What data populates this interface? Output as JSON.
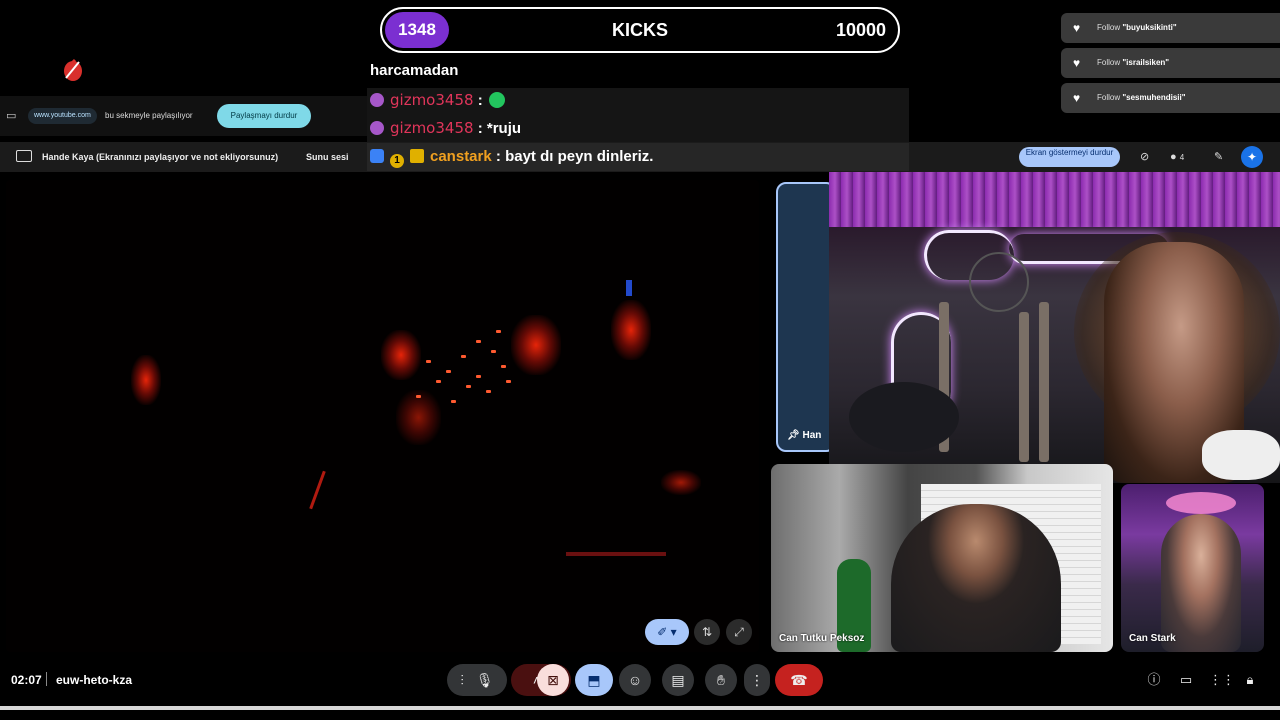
{
  "kicks": {
    "current": "1348",
    "label": "KICKS",
    "goal": "10000"
  },
  "chat": [
    {
      "user": "",
      "message": "harcamadan"
    },
    {
      "user": "gizmo3458",
      "sep": ":",
      "message": ""
    },
    {
      "user": "gizmo3458",
      "sep": ":",
      "message": "*ruju"
    },
    {
      "user": "canstark",
      "sep": ":",
      "message": "bayt dı peyn dinleriz.",
      "badge_num": "1"
    }
  ],
  "follows": [
    {
      "prefix": "Follow",
      "name": "\"buyuksikinti\""
    },
    {
      "prefix": "Follow",
      "name": "\"israilsiken\""
    },
    {
      "prefix": "Follow",
      "name": "\"sesmuhendisii\""
    }
  ],
  "share_bar": {
    "url": "www.youtube.com",
    "text": "bu sekmeyle paylaşılıyor",
    "stop_label": "Paylaşmayı durdur"
  },
  "presenter_bar": {
    "text": "Hande Kaya (Ekranınızı paylaşıyor ve not ekliyorsunuz)",
    "audio_label": "Sunu sesi",
    "stop_present_label": "Ekran göstermeyi durdur",
    "people_count": "4"
  },
  "tiles": {
    "hande_label": "Han",
    "can_tutku": "Can Tutku Peksoz",
    "can_stark": "Can Stark"
  },
  "meeting": {
    "time": "02:07",
    "code": "euw-heto-kza"
  },
  "colors": {
    "accent": "#a8c7fa",
    "kicks_purple": "#7b2fd1",
    "end_call_red": "#c5221f",
    "chat_red": "#e0355a",
    "chat_orange": "#f0a020"
  }
}
